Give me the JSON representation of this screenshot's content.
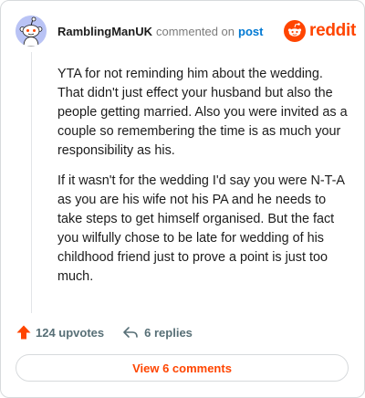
{
  "comment": {
    "username": "RamblingManUK",
    "action_text": "commented on",
    "post_link_label": "post",
    "paragraphs": [
      "YTA for not reminding him about the wedding. That didn't just effect your husband but also the people getting married. Also you were invited as a couple so remembering the time is as much your responsibility as his.",
      "If it wasn't for the wedding I'd say you were N-T-A as you are his wife not his PA and he needs to take steps to get himself organised. But the fact you wilfully chose to be late for wedding of his childhood friend just to prove a point is just too much."
    ],
    "upvotes_label": "124 upvotes",
    "replies_label": "6 replies",
    "view_comments_label": "View 6 comments"
  },
  "branding": {
    "logo_text": "reddit"
  },
  "icons": {
    "avatar": "snoo-avatar-icon",
    "logo": "reddit-logo-icon",
    "upvote": "upvote-arrow-icon",
    "reply": "reply-arrow-icon"
  },
  "colors": {
    "accent": "#ff4500",
    "link": "#0079d3",
    "avatar_bg": "#b9c3f5",
    "muted": "#7c7c7c"
  }
}
